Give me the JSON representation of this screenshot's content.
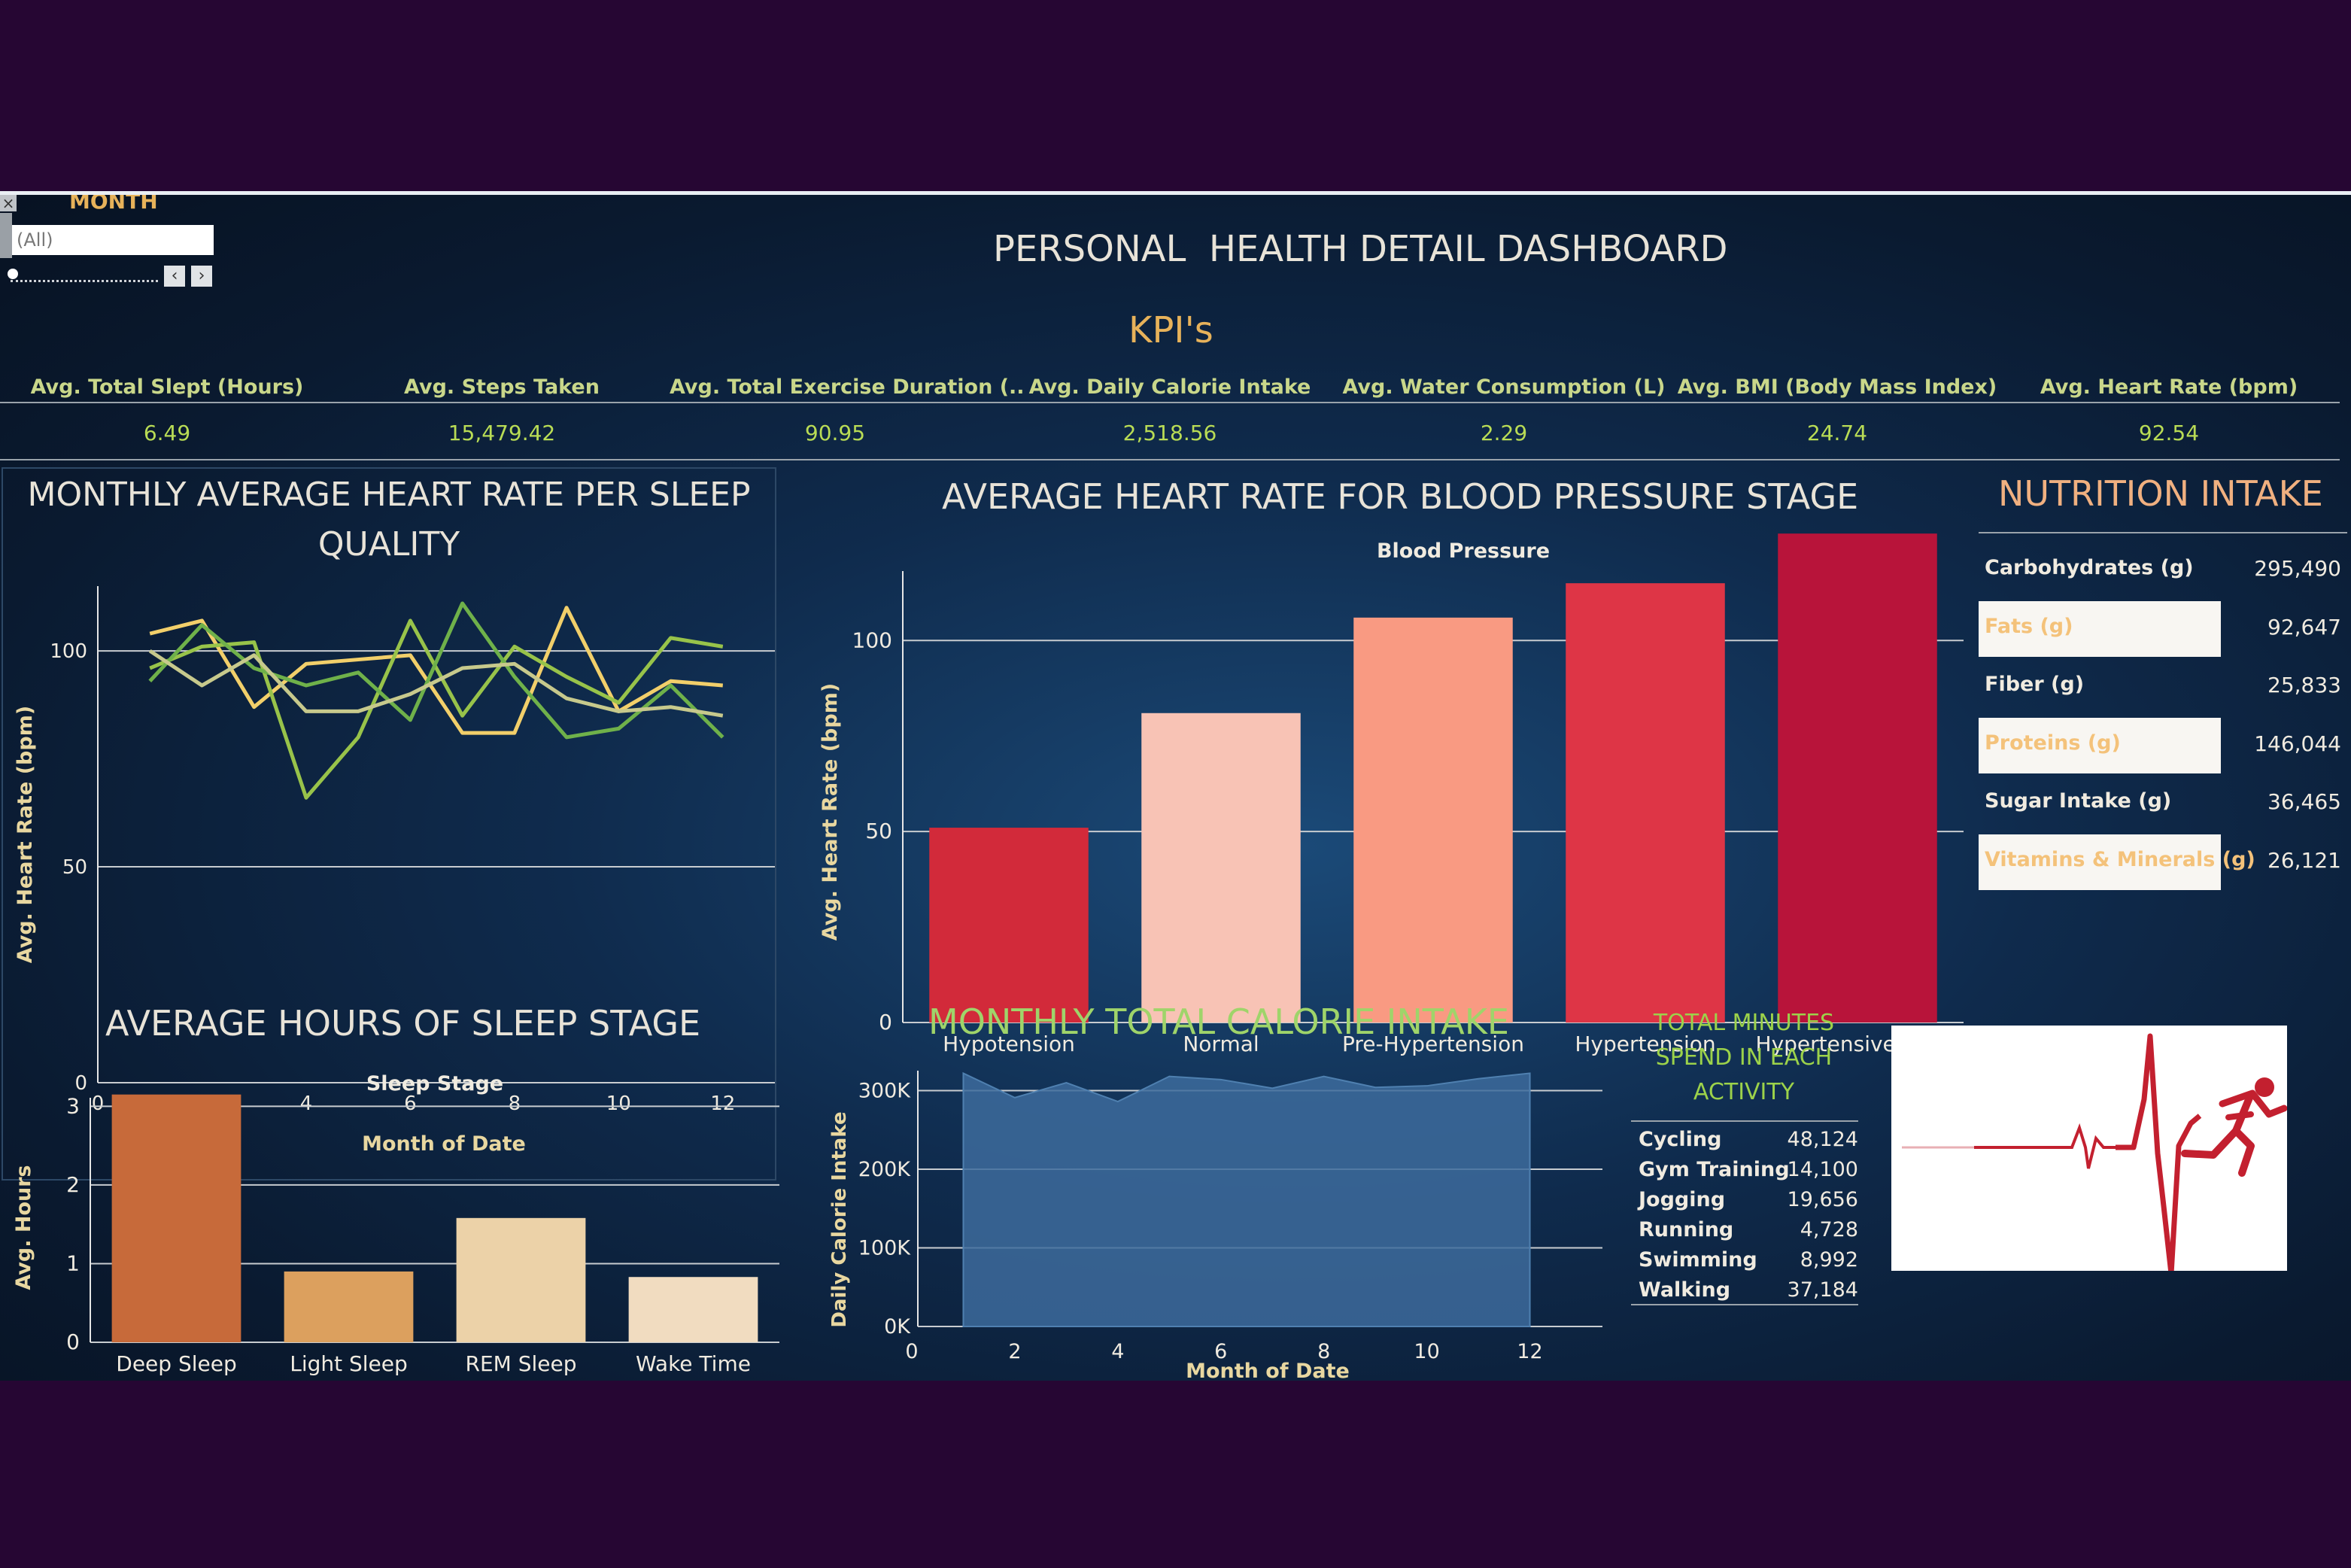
{
  "filter": {
    "label": "MONTH",
    "value": "(All)"
  },
  "title": "PERSONAL  HEALTH DETAIL DASHBOARD",
  "kpi_title": "KPI's",
  "kpis": [
    {
      "label": "Avg. Total Slept (Hours)",
      "value": "6.49"
    },
    {
      "label": "Avg. Steps Taken",
      "value": "15,479.42"
    },
    {
      "label": "Avg. Total Exercise Duration (..",
      "value": "90.95"
    },
    {
      "label": "Avg. Daily Calorie Intake",
      "value": "2,518.56"
    },
    {
      "label": "Avg. Water Consumption (L)",
      "value": "2.29"
    },
    {
      "label": "Avg. BMI (Body Mass Index)",
      "value": "24.74"
    },
    {
      "label": "Avg. Heart Rate (bpm)",
      "value": "92.54"
    }
  ],
  "heart_rate_panel": {
    "title_line1": "MONTHLY AVERAGE HEART RATE PER SLEEP",
    "title_line2": "QUALITY"
  },
  "bp_panel": {
    "title": "AVERAGE HEART RATE FOR BLOOD PRESSURE STAGE"
  },
  "nutrition": {
    "title": "NUTRITION INTAKE",
    "items": [
      {
        "label": "Carbohydrates (g)",
        "value": "295,490",
        "highlight": false
      },
      {
        "label": "Fats (g)",
        "value": "92,647",
        "highlight": true
      },
      {
        "label": "Fiber (g)",
        "value": "25,833",
        "highlight": false
      },
      {
        "label": "Proteins (g)",
        "value": "146,044",
        "highlight": true
      },
      {
        "label": "Sugar Intake (g)",
        "value": "36,465",
        "highlight": false
      },
      {
        "label": "Vitamins & Minerals (g)",
        "value": "26,121",
        "highlight": true
      }
    ]
  },
  "sleep_panel": {
    "title": "AVERAGE HOURS OF SLEEP STAGE"
  },
  "calorie_panel": {
    "title": "MONTHLY TOTAL CALORIE INTAKE"
  },
  "activity": {
    "title_line1": "TOTAL MINUTES",
    "title_line2": "SPEND IN EACH",
    "title_line3": "ACTIVITY",
    "items": [
      {
        "label": "Cycling",
        "value": "48,124"
      },
      {
        "label": "Gym Training",
        "value": "14,100"
      },
      {
        "label": "Jogging",
        "value": "19,656"
      },
      {
        "label": "Running",
        "value": "4,728"
      },
      {
        "label": "Swimming",
        "value": "8,992"
      },
      {
        "label": "Walking",
        "value": "37,184"
      }
    ]
  },
  "logo": {
    "icon": "heartbeat-runner-icon",
    "color": "#c3202f"
  },
  "colors": {
    "background": "#260633",
    "panel": "#0f2b4d",
    "title_text": "#e8e3d8",
    "gold": "#e7b25a",
    "green": "#9cd24a"
  },
  "chart_data": [
    {
      "type": "line",
      "xlabel": "Month of Date",
      "ylabel": "Avg. Heart Rate (bpm)",
      "xlim": [
        0,
        13
      ],
      "ylim": [
        0,
        115
      ],
      "x_ticks": [
        0,
        2,
        4,
        6,
        8,
        10,
        12
      ],
      "y_ticks": [
        0,
        50,
        100
      ],
      "x": [
        1,
        2,
        3,
        4,
        5,
        6,
        7,
        8,
        9,
        10,
        11,
        12
      ],
      "series": [
        {
          "color": "#f2cf6a",
          "values": [
            104,
            107,
            87,
            97,
            98,
            99,
            81,
            81,
            110,
            86,
            93,
            92
          ]
        },
        {
          "color": "#98c34a",
          "values": [
            96,
            101,
            102,
            66,
            80,
            107,
            85,
            101,
            94,
            88,
            103,
            101
          ]
        },
        {
          "color": "#6fb14a",
          "values": [
            93,
            106,
            96,
            92,
            95,
            84,
            111,
            94,
            80,
            82,
            92,
            80
          ]
        },
        {
          "color": "#c7c98c",
          "values": [
            100,
            92,
            99,
            86,
            86,
            90,
            96,
            97,
            89,
            86,
            87,
            85
          ]
        }
      ],
      "grid": true
    },
    {
      "type": "bar",
      "title": "Blood Pressure",
      "ylabel": "Avg. Heart Rate (bpm)",
      "ylim": [
        0,
        130
      ],
      "y_ticks": [
        0,
        50,
        100
      ],
      "categories": [
        "Hypotension",
        "Normal",
        "Pre-Hypertension",
        "Hypertension",
        "Hypertensive Crisis"
      ],
      "values": [
        51,
        81,
        106,
        115,
        128
      ],
      "colors": [
        "#d22a3a",
        "#f8c3b5",
        "#f99a82",
        "#de3546",
        "#b8143a"
      ],
      "grid": true
    },
    {
      "type": "bar",
      "title": "Sleep Stage",
      "ylabel": "Avg. Hours",
      "ylim": [
        0,
        3.3
      ],
      "y_ticks": [
        0,
        1,
        2,
        3
      ],
      "categories": [
        "Deep Sleep",
        "Light Sleep",
        "REM Sleep",
        "Wake Time"
      ],
      "values": [
        3.15,
        0.9,
        1.58,
        0.83
      ],
      "colors": [
        "#c76a3a",
        "#dca05e",
        "#ecd2a8",
        "#f1dcc0"
      ],
      "grid": true
    },
    {
      "type": "area",
      "xlabel": "Month of Date",
      "ylabel": "Daily Calorie Intake",
      "xlim": [
        0,
        13
      ],
      "ylim": [
        0,
        310000
      ],
      "x_ticks": [
        0,
        2,
        4,
        6,
        8,
        10,
        12
      ],
      "y_ticks": [
        0,
        100000,
        200000,
        300000
      ],
      "y_tick_labels": [
        "0K",
        "100K",
        "200K",
        "300K"
      ],
      "x": [
        1,
        2,
        3,
        4,
        5,
        6,
        7,
        8,
        9,
        10,
        11,
        12
      ],
      "values": [
        322000,
        291000,
        310000,
        286000,
        318000,
        314000,
        303000,
        318000,
        304000,
        306000,
        315000,
        322000
      ],
      "color": "#3d6b9c",
      "grid": true
    }
  ]
}
